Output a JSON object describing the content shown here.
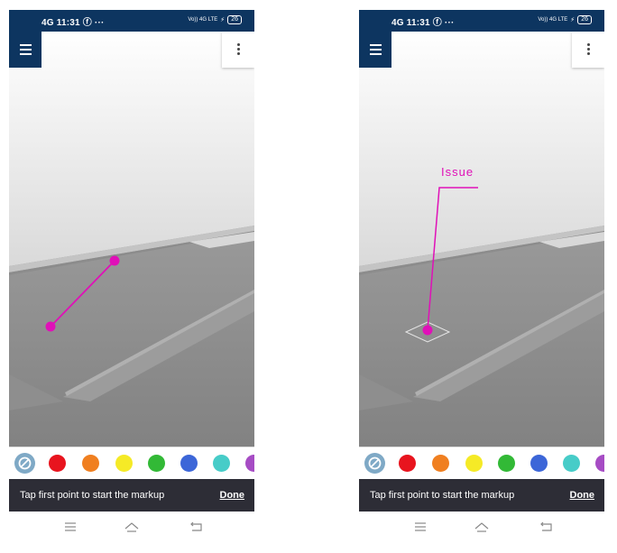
{
  "status_bar": {
    "time": "11:31",
    "network_left": "4G",
    "battery": "26",
    "network_right": "Vo)) 4G LTE"
  },
  "icons": {
    "menu": "hamburger-menu-icon",
    "more": "vertical-more-icon",
    "no_color": "no-color-slash-icon",
    "nav_recents": "nav-recents-icon",
    "nav_home": "nav-home-icon",
    "nav_back": "nav-back-icon"
  },
  "palette": {
    "colors": [
      "#e8141e",
      "#f07f20",
      "#f5ea26",
      "#32b936",
      "#3c66d8",
      "#47ccc8",
      "#a64cc4"
    ]
  },
  "left_screen": {
    "hint": "Tap first point to start the markup",
    "done_label": "Done"
  },
  "right_screen": {
    "hint": "Tap first point to start the markup",
    "done_label": "Done",
    "annotation_label": "Issue"
  },
  "markup_color": "#e010b8",
  "brand_color": "#0d3560"
}
